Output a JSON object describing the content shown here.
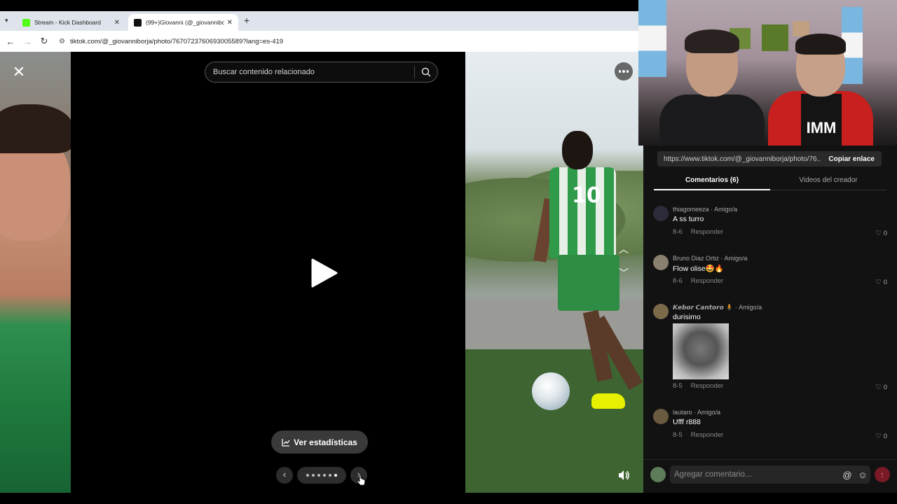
{
  "browser": {
    "tabs": [
      {
        "title": "Stream - Kick Dashboard",
        "favicon_color": "#53fc18"
      },
      {
        "title": "(99+)Giovanni (@_giovanniborj",
        "favicon_color": "#111111"
      }
    ],
    "url": "tiktok.com/@_giovanniborja/photo/7670723760693005589?lang=es-419"
  },
  "viewer": {
    "search_placeholder": "Buscar contenido relacionado",
    "stats_label": "Ver estadísticas",
    "page_dots": 6,
    "active_dot": 5,
    "player_number": "10"
  },
  "sidebar": {
    "share_url": "https://www.tiktok.com/@_giovanniborja/photo/76...",
    "copy_label": "Copiar enlace",
    "tabs": [
      "Comentarios (6)",
      "Videos del creador"
    ],
    "comments": [
      {
        "author": "thiagomeeza",
        "relation": "· Amigo/a",
        "text": "A ss turro",
        "date": "8-6",
        "reply": "Responder",
        "likes": "0"
      },
      {
        "author": "Bruno Diaz Ortiz",
        "relation": "· Amigo/a",
        "text": "Flow olise🤩🔥",
        "date": "8-6",
        "reply": "Responder",
        "likes": "0"
      },
      {
        "author": "𝙆𝙚𝙗𝙤𝙧 𝘾𝙖𝙣𝙩𝙤𝙧𝙤 🧍",
        "relation": "· Amigo/a",
        "text": "durisimo",
        "date": "8-5",
        "reply": "Responder",
        "likes": "0"
      },
      {
        "author": "lautaro",
        "relation": "· Amigo/a",
        "text": "Ufff r888",
        "date": "8-5",
        "reply": "Responder",
        "likes": "0"
      }
    ],
    "comment_placeholder": "Agregar comentario..."
  },
  "webcam": {
    "shirt_text": "IMM"
  }
}
